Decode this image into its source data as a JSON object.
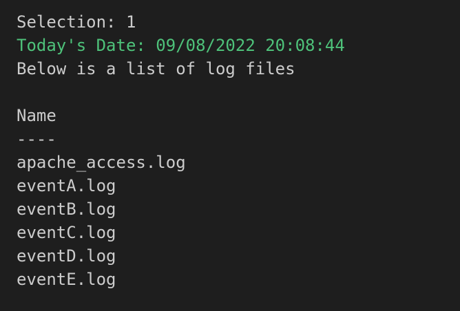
{
  "terminal": {
    "selection": "Selection: 1",
    "date": "Today's Date: 09/08/2022 20:08:44",
    "intro": "Below is a list of log files",
    "header": "Name",
    "divider": "----",
    "files": [
      "apache_access.log",
      "eventA.log",
      "eventB.log",
      "eventC.log",
      "eventD.log",
      "eventE.log"
    ]
  },
  "colors": {
    "background": "#1e1e1e",
    "text": "#cccccc",
    "date_text": "#4ec27a"
  }
}
